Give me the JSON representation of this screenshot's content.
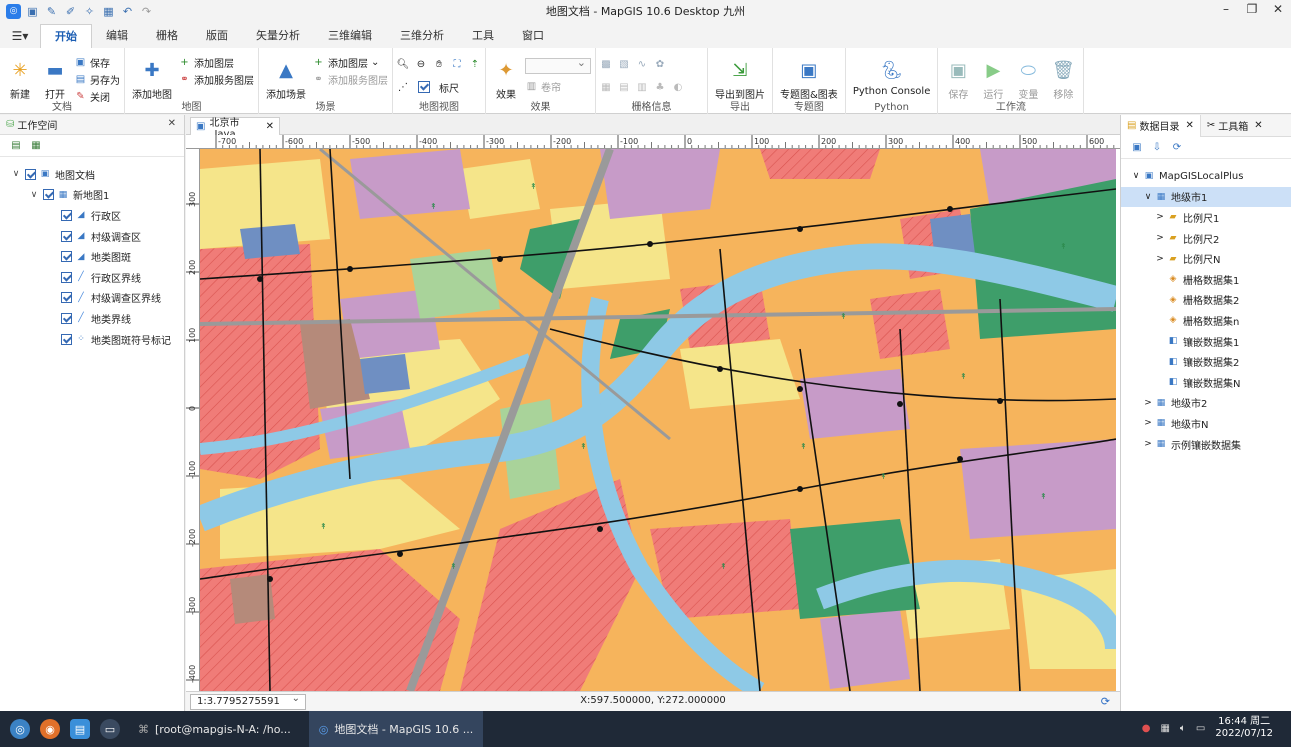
{
  "window": {
    "title": "地图文档 - MapGIS 10.6 Desktop 九州"
  },
  "ribbon_tabs": [
    "开始",
    "编辑",
    "栅格",
    "版面",
    "矢量分析",
    "三维编辑",
    "三维分析",
    "工具",
    "窗口"
  ],
  "ribbon": {
    "doc": {
      "new": "新建",
      "open": "打开",
      "save": "保存",
      "saveas": "另存为",
      "close": "关闭",
      "group": "文档"
    },
    "map": {
      "addmap": "添加地图",
      "addlayer": "添加图层",
      "addservice": "添加服务图层",
      "group": "地图"
    },
    "scene": {
      "addscene": "添加场景",
      "addlayer": "添加图层",
      "addservice": "添加服务图层",
      "group": "场景"
    },
    "mapview": {
      "ruler": "标尺",
      "group": "地图视图"
    },
    "effect": {
      "effect": "效果",
      "curtain": "卷帘",
      "group": "效果"
    },
    "raster": {
      "group": "栅格信息"
    },
    "export": {
      "export_img": "导出到图片",
      "group": "导出"
    },
    "thematic": {
      "label": "专题图&图表",
      "group": "专题图"
    },
    "python": {
      "label": "Python Console",
      "group": "Python"
    },
    "workflow": {
      "save": "保存",
      "run": "运行",
      "var": "变量",
      "remove": "移除",
      "group": "工作流"
    }
  },
  "workspace": {
    "title": "工作空间",
    "tree": [
      {
        "label": "地图文档",
        "level": 0
      },
      {
        "label": "新地图1",
        "level": 1
      },
      {
        "label": "行政区",
        "level": 2
      },
      {
        "label": "村级调查区",
        "level": 2
      },
      {
        "label": "地类图斑",
        "level": 2
      },
      {
        "label": "行政区界线",
        "level": 2
      },
      {
        "label": "村级调查区界线",
        "level": 2
      },
      {
        "label": "地类界线",
        "level": 2
      },
      {
        "label": "地类图斑符号标记",
        "level": 2
      }
    ]
  },
  "doc_tab": {
    "label": "北京市_Java"
  },
  "catalog": {
    "tab1": "数据目录",
    "tab2": "工具箱",
    "tree": [
      {
        "label": "MapGISLocalPlus",
        "level": 0,
        "chev": "∨"
      },
      {
        "label": "地级市1",
        "level": 1,
        "chev": "∨",
        "selected": true
      },
      {
        "label": "比例尺1",
        "level": 2,
        "chev": ">"
      },
      {
        "label": "比例尺2",
        "level": 2,
        "chev": ">"
      },
      {
        "label": "比例尺N",
        "level": 2,
        "chev": ">"
      },
      {
        "label": "栅格数据集1",
        "level": 2,
        "chev": ""
      },
      {
        "label": "栅格数据集2",
        "level": 2,
        "chev": ""
      },
      {
        "label": "栅格数据集n",
        "level": 2,
        "chev": ""
      },
      {
        "label": "镶嵌数据集1",
        "level": 2,
        "chev": ""
      },
      {
        "label": "镶嵌数据集2",
        "level": 2,
        "chev": ""
      },
      {
        "label": "镶嵌数据集N",
        "level": 2,
        "chev": ""
      },
      {
        "label": "地级市2",
        "level": 1,
        "chev": ">"
      },
      {
        "label": "地级市N",
        "level": 1,
        "chev": ">"
      },
      {
        "label": "示例镶嵌数据集",
        "level": 1,
        "chev": ">"
      }
    ]
  },
  "ruler": {
    "top": [
      "-700",
      "-600",
      "-500",
      "-400",
      "-300",
      "-200",
      "-100",
      "0",
      "100",
      "200",
      "300",
      "400",
      "500",
      "600"
    ],
    "left": [
      "300",
      "200",
      "100",
      "0",
      "-100",
      "-200",
      "-300",
      "-400"
    ]
  },
  "status": {
    "scale": "1:3.7795275591",
    "coords": "X:597.500000, Y:272.000000"
  },
  "taskbar": {
    "task1": "[root@mapgis-N-A: /ho...",
    "task2": "地图文档 - MapGIS 10.6 ...",
    "time": "16:44 周二",
    "date": "2022/07/12"
  },
  "colors": {
    "accent": "#1d5fb4",
    "selection": "#cce0f7",
    "taskbar": "#1f2937",
    "water": "#8ec9e6"
  }
}
